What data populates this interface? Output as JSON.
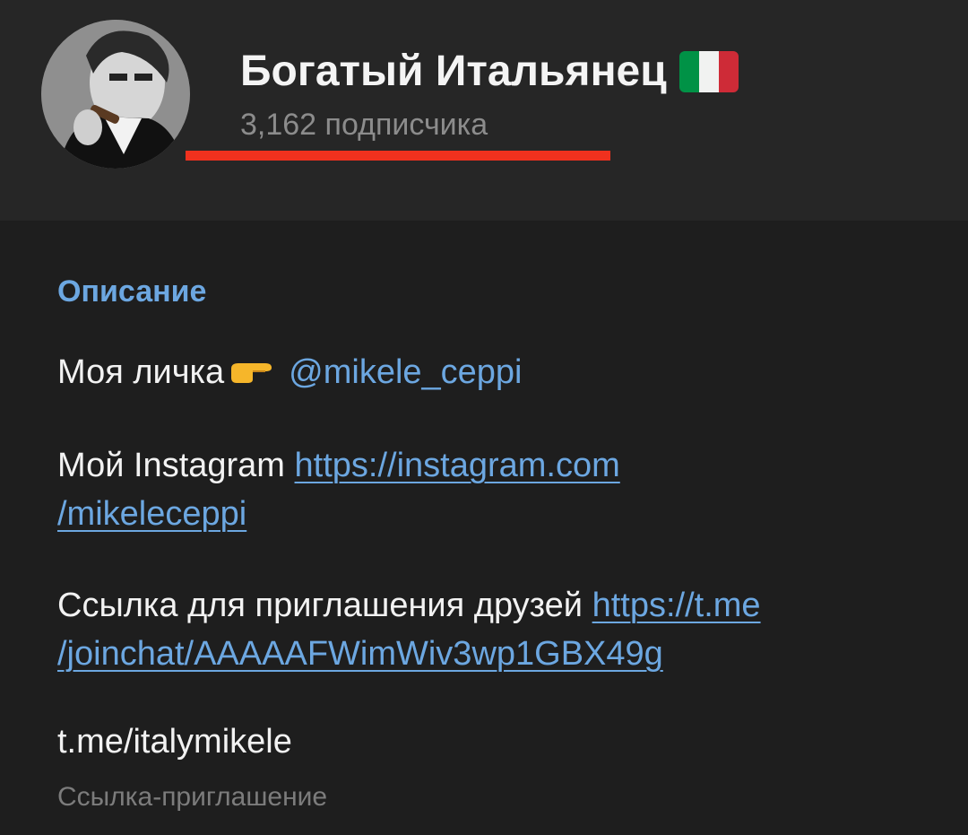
{
  "channel": {
    "title": "Богатый Итальянец",
    "flag_icon": "italy-flag-icon",
    "subscribers": "3,162 подписчика"
  },
  "colors": {
    "background": "#1e1e1e",
    "header_background": "#262626",
    "accent_link": "#6ca7e1",
    "annotation_red": "#f0311e",
    "flag_green": "#009246",
    "flag_white": "#f1f2f1",
    "flag_red": "#ce2b37"
  },
  "description": {
    "label": "Описание",
    "line1_text": "Моя личка",
    "line1_emoji": "pointing-right-icon",
    "line1_mention": "@mikele_ceppi",
    "line2_text": "Мой Instagram",
    "line2_link_part1": "https://instagram.com",
    "line2_link_part2": "/mikeleceppi",
    "line3_text": "Ссылка для приглашения друзей",
    "line3_link_part1": "https://t.me",
    "line3_link_part2": "/joinchat/AAAAAFWimWiv3wp1GBX49g"
  },
  "invite": {
    "link": "t.me/italymikele",
    "caption": "Ссылка-приглашение"
  }
}
